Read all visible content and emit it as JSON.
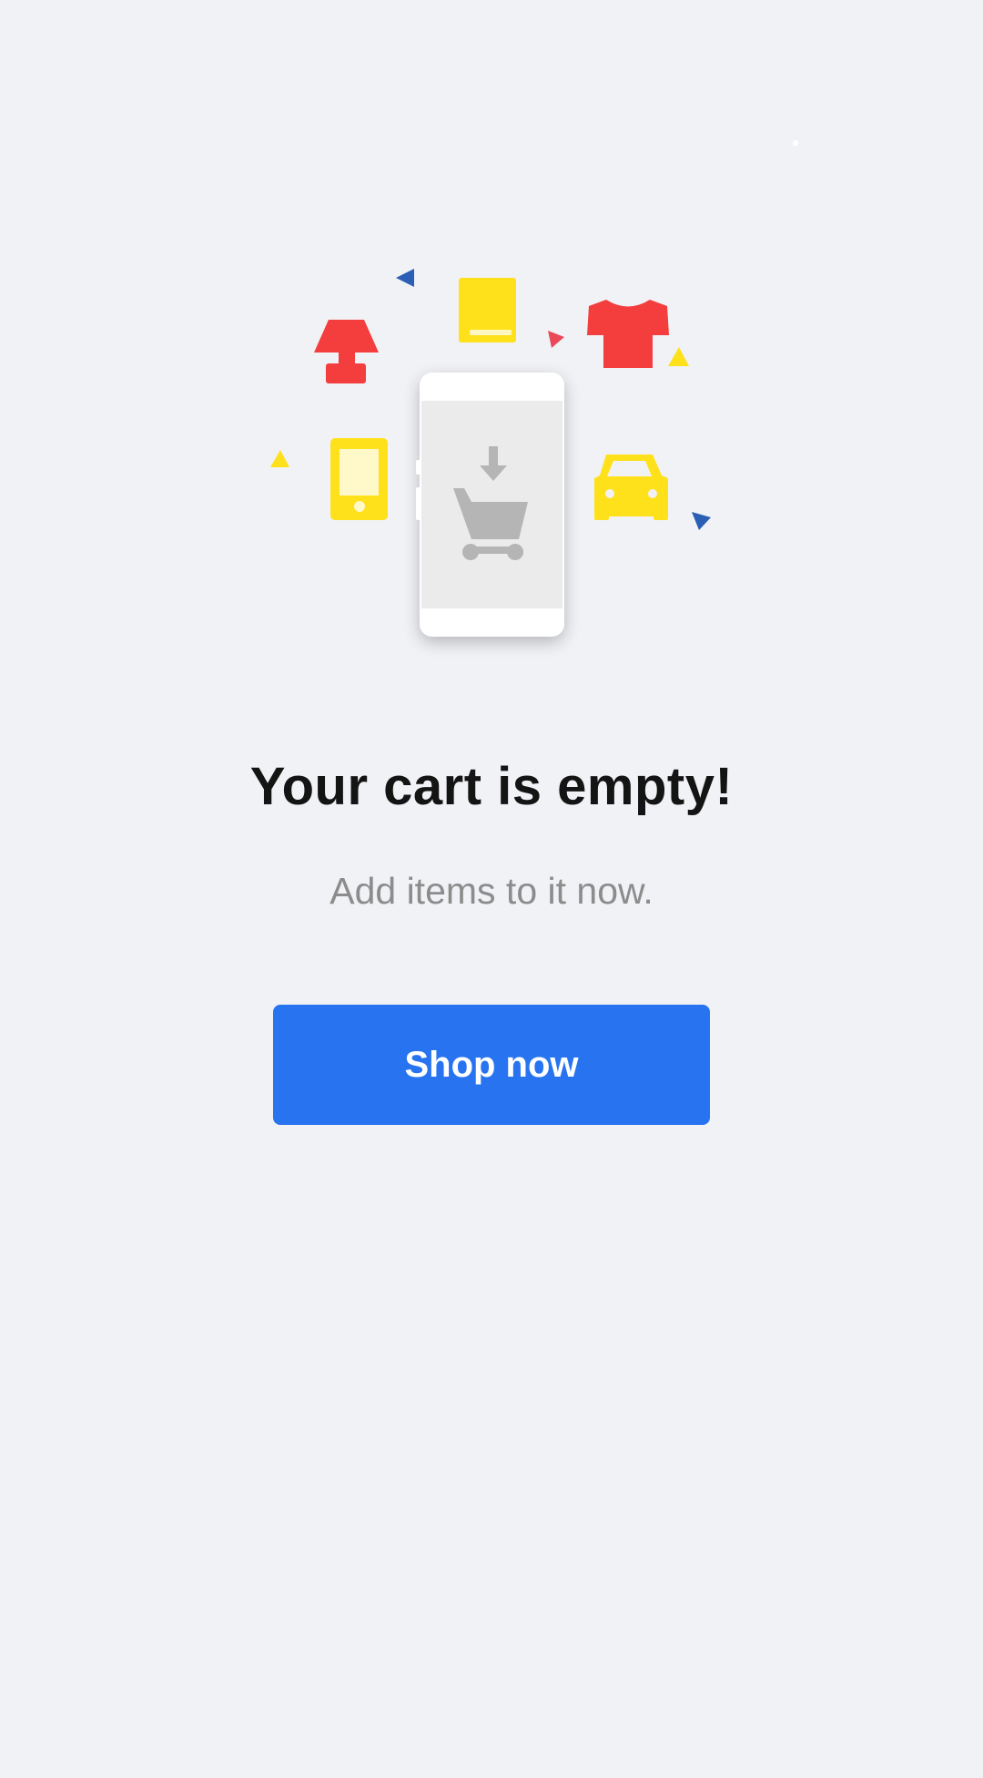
{
  "empty_state": {
    "title": "Your cart is empty!",
    "subtitle": "Add items to it now.",
    "button_label": "Shop now"
  },
  "colors": {
    "background": "#f1f2f6",
    "button": "#2874f0",
    "red": "#f43d3d",
    "yellow": "#ffe11b",
    "blue": "#2a5fb5",
    "cart_grey": "#b5b5b5"
  }
}
